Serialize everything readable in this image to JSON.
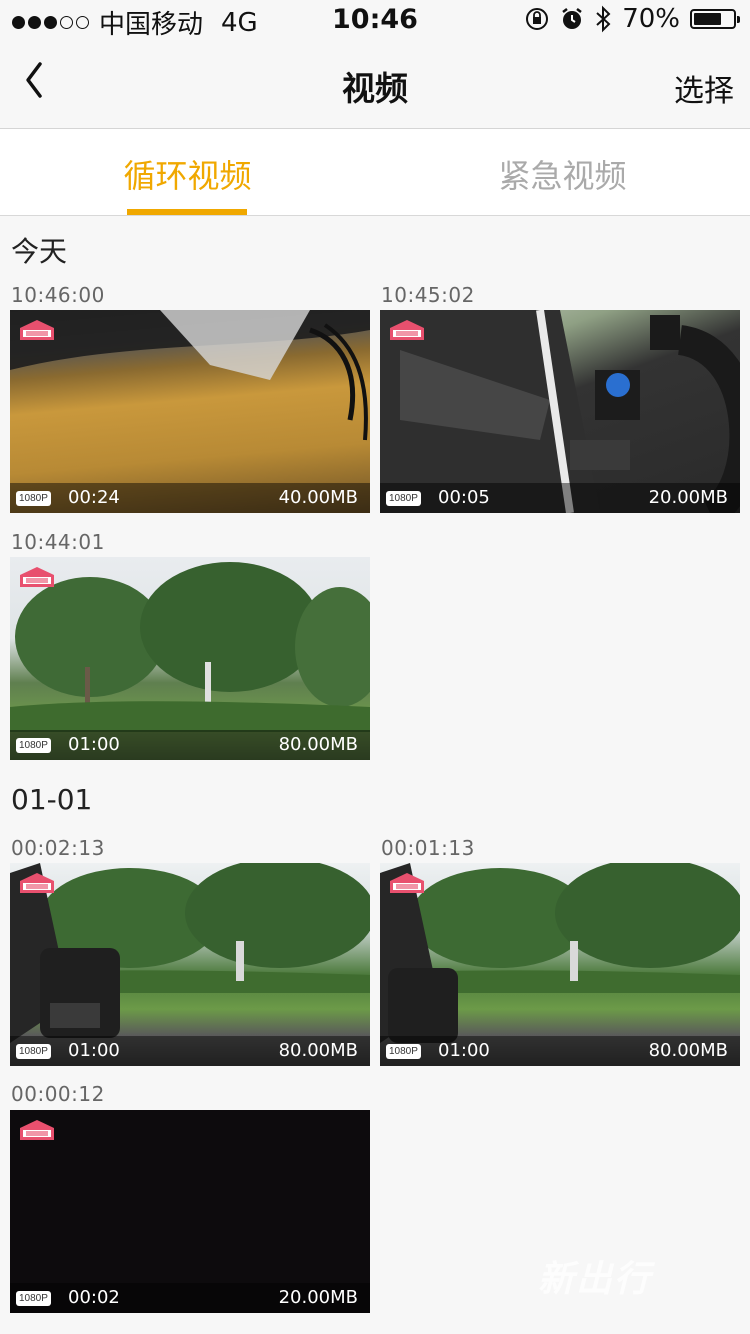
{
  "status_bar": {
    "carrier": "中国移动",
    "network": "4G",
    "time": "10:46",
    "battery_percent": "70%",
    "battery_level": 0.7,
    "icons": [
      "orientation-lock-icon",
      "alarm-icon",
      "bluetooth-icon"
    ]
  },
  "nav": {
    "back_icon": "chevron-left-icon",
    "title": "视频",
    "select_label": "选择"
  },
  "tabs": [
    {
      "label": "循环视频",
      "active": true
    },
    {
      "label": "紧急视频",
      "active": false
    }
  ],
  "sections": [
    {
      "title": "今天",
      "videos": [
        {
          "time": "10:46:00",
          "resolution": "1080P",
          "duration": "00:24",
          "size": "40.00MB",
          "scene": "car-interior-tan"
        },
        {
          "time": "10:45:02",
          "resolution": "1080P",
          "duration": "00:05",
          "size": "20.00MB",
          "scene": "car-door-steering"
        },
        {
          "time": "10:44:01",
          "resolution": "1080P",
          "duration": "01:00",
          "size": "80.00MB",
          "scene": "trees-grass"
        }
      ]
    },
    {
      "title": "01-01",
      "videos": [
        {
          "time": "00:02:13",
          "resolution": "1080P",
          "duration": "01:00",
          "size": "80.00MB",
          "scene": "dashcam-trees-pedestrian"
        },
        {
          "time": "00:01:13",
          "resolution": "1080P",
          "duration": "01:00",
          "size": "80.00MB",
          "scene": "dashcam-trees"
        },
        {
          "time": "00:00:12",
          "resolution": "1080P",
          "duration": "00:02",
          "size": "20.00MB",
          "scene": "dark"
        }
      ]
    }
  ],
  "colors": {
    "accent": "#f0a800",
    "inactive_tab": "#aaaaaa",
    "background": "#f7f7f7"
  },
  "watermark": "新出行"
}
